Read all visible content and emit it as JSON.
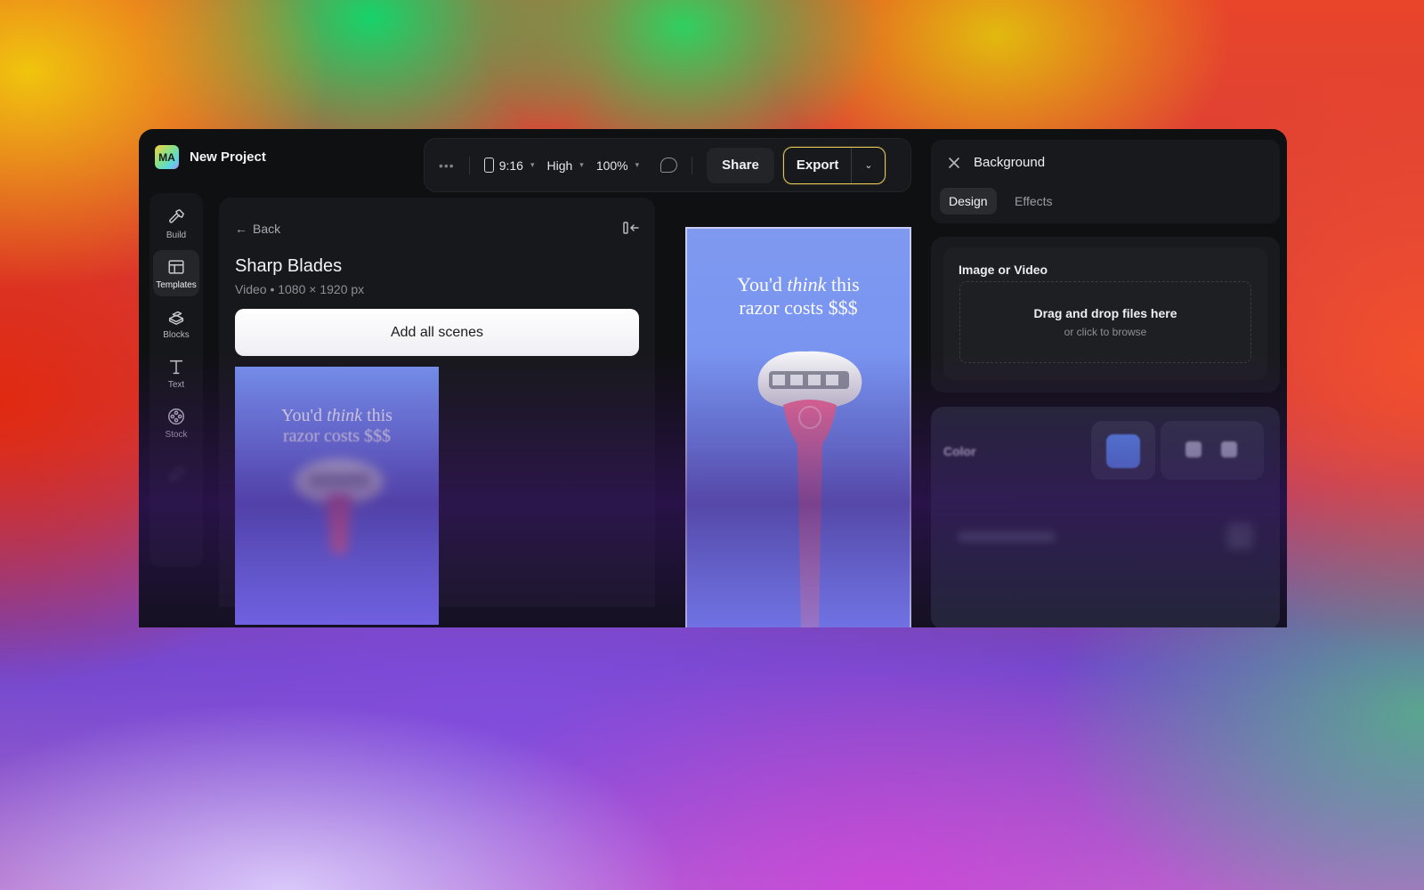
{
  "header": {
    "avatar_initials": "MA",
    "project_name": "New Project"
  },
  "toolbar": {
    "more_label": "•••",
    "aspect_ratio": "9:16",
    "quality": "High",
    "zoom": "100%",
    "share_label": "Share",
    "export_label": "Export"
  },
  "rail": {
    "items": [
      {
        "label": "Build",
        "icon": "hammer-icon"
      },
      {
        "label": "Templates",
        "icon": "layout-icon"
      },
      {
        "label": "Blocks",
        "icon": "blocks-icon"
      },
      {
        "label": "Text",
        "icon": "text-icon"
      },
      {
        "label": "Stock",
        "icon": "film-reel-icon"
      }
    ],
    "active": "Templates"
  },
  "templates_panel": {
    "back_label": "Back",
    "title": "Sharp Blades",
    "meta": "Video • 1080 × 1920 px",
    "add_all_label": "Add all scenes",
    "thumb_line1_a": "You'd ",
    "thumb_line1_em": "think",
    "thumb_line1_b": " this",
    "thumb_line2": "razor costs $$$"
  },
  "preview": {
    "line1_a": "You'd ",
    "line1_em": "think",
    "line1_b": " this",
    "line2": "razor costs $$$"
  },
  "inspector": {
    "title": "Background",
    "tabs": [
      "Design",
      "Effects"
    ],
    "active_tab": "Design",
    "upload_label": "Image or Video",
    "drop_main": "Drag and drop files here",
    "drop_sub": "or click to browse",
    "color_label": "Color",
    "color_value": "#5b95f4"
  },
  "colors": {
    "accent_export_border": "#e3c957",
    "canvas_bg": "#7592f1"
  }
}
